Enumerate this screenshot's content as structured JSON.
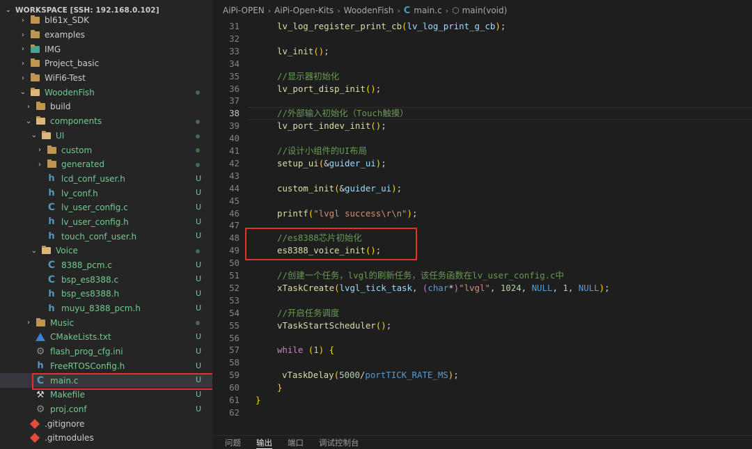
{
  "workspace_header": "WORKSPACE [SSH: 192.168.0.102]",
  "tree": [
    {
      "label": "bl61x_SDK",
      "type": "folder",
      "level": 1,
      "expanded": false
    },
    {
      "label": "examples",
      "type": "folder",
      "level": 1,
      "expanded": false
    },
    {
      "label": "IMG",
      "type": "folder-img",
      "level": 1,
      "expanded": false
    },
    {
      "label": "Project_basic",
      "type": "folder",
      "level": 1,
      "expanded": false
    },
    {
      "label": "WiFi6-Test",
      "type": "folder",
      "level": 1,
      "expanded": false
    },
    {
      "label": "WoodenFish",
      "type": "folder-open",
      "level": 1,
      "expanded": true,
      "dot": true,
      "git": "new"
    },
    {
      "label": "build",
      "type": "folder",
      "level": 2,
      "expanded": false
    },
    {
      "label": "components",
      "type": "folder-open",
      "level": 2,
      "expanded": true,
      "dot": true,
      "git": "new"
    },
    {
      "label": "UI",
      "type": "folder-open",
      "level": 3,
      "expanded": true,
      "dot": true,
      "git": "new"
    },
    {
      "label": "custom",
      "type": "folder",
      "level": 4,
      "expanded": false,
      "dot": true,
      "git": "new"
    },
    {
      "label": "generated",
      "type": "folder",
      "level": 4,
      "expanded": false,
      "dot": true,
      "git": "new"
    },
    {
      "label": "lcd_conf_user.h",
      "type": "h",
      "level": 4,
      "badge": "U",
      "git": "new"
    },
    {
      "label": "lv_conf.h",
      "type": "h",
      "level": 4,
      "badge": "U",
      "git": "new"
    },
    {
      "label": "lv_user_config.c",
      "type": "c",
      "level": 4,
      "badge": "U",
      "git": "new"
    },
    {
      "label": "lv_user_config.h",
      "type": "h",
      "level": 4,
      "badge": "U",
      "git": "new"
    },
    {
      "label": "touch_conf_user.h",
      "type": "h",
      "level": 4,
      "badge": "U",
      "git": "new"
    },
    {
      "label": "Voice",
      "type": "folder-open",
      "level": 3,
      "expanded": true,
      "dot": true,
      "git": "new"
    },
    {
      "label": "8388_pcm.c",
      "type": "c",
      "level": 4,
      "badge": "U",
      "git": "new"
    },
    {
      "label": "bsp_es8388.c",
      "type": "c",
      "level": 4,
      "badge": "U",
      "git": "new"
    },
    {
      "label": "bsp_es8388.h",
      "type": "h",
      "level": 4,
      "badge": "U",
      "git": "new"
    },
    {
      "label": "muyu_8388_pcm.h",
      "type": "h",
      "level": 4,
      "badge": "U",
      "git": "new"
    },
    {
      "label": "Music",
      "type": "folder",
      "level": 2,
      "expanded": false,
      "dot": true,
      "git": "new"
    },
    {
      "label": "CMakeLists.txt",
      "type": "cmake",
      "level": 2,
      "badge": "U",
      "git": "new"
    },
    {
      "label": "flash_prog_cfg.ini",
      "type": "gear",
      "level": 2,
      "badge": "U",
      "git": "new"
    },
    {
      "label": "FreeRTOSConfig.h",
      "type": "h",
      "level": 2,
      "badge": "U",
      "git": "new"
    },
    {
      "label": "main.c",
      "type": "c",
      "level": 2,
      "badge": "U",
      "git": "new",
      "selected": true
    },
    {
      "label": "Makefile",
      "type": "make",
      "level": 2,
      "badge": "U",
      "git": "new"
    },
    {
      "label": "proj.conf",
      "type": "gear",
      "level": 2,
      "badge": "U",
      "git": "new"
    },
    {
      "label": ".gitignore",
      "type": "git",
      "level": 1
    },
    {
      "label": ".gitmodules",
      "type": "git",
      "level": 1
    }
  ],
  "breadcrumb": {
    "items": [
      "AiPi-OPEN",
      "AiPi-Open-Kits",
      "WoodenFish"
    ],
    "file": "main.c",
    "symbol": "main(void)"
  },
  "code": {
    "current_line": 38,
    "lines": [
      {
        "n": "31",
        "text": "lv_log_register_print_cb(lv_log_print_g_cb);"
      },
      {
        "n": "32",
        "text": ""
      },
      {
        "n": "33",
        "text": "lv_init();"
      },
      {
        "n": "34",
        "text": ""
      },
      {
        "n": "35",
        "text": "//显示器初始化"
      },
      {
        "n": "36",
        "text": "lv_port_disp_init();"
      },
      {
        "n": "37",
        "text": ""
      },
      {
        "n": "38",
        "text": "//外部输入初始化（Touch触摸）"
      },
      {
        "n": "39",
        "text": "lv_port_indev_init();"
      },
      {
        "n": "40",
        "text": ""
      },
      {
        "n": "41",
        "text": "//设计小组件的UI布局"
      },
      {
        "n": "42",
        "text": "setup_ui(&guider_ui);"
      },
      {
        "n": "43",
        "text": ""
      },
      {
        "n": "44",
        "text": "custom_init(&guider_ui);"
      },
      {
        "n": "45",
        "text": ""
      },
      {
        "n": "46",
        "text": "printf(\"lvgl success\\r\\n\");"
      },
      {
        "n": "47",
        "text": ""
      },
      {
        "n": "48",
        "text": "//es8388芯片初始化"
      },
      {
        "n": "49",
        "text": "es8388_voice_init();"
      },
      {
        "n": "50",
        "text": ""
      },
      {
        "n": "51",
        "text": "//创建一个任务，lvgl的刷新任务，该任务函数在lv_user_config.c中"
      },
      {
        "n": "52",
        "text": "xTaskCreate(lvgl_tick_task, (char*)\"lvgl\", 1024, NULL, 1, NULL);"
      },
      {
        "n": "53",
        "text": ""
      },
      {
        "n": "54",
        "text": "//开启任务调度"
      },
      {
        "n": "55",
        "text": "vTaskStartScheduler();"
      },
      {
        "n": "56",
        "text": ""
      },
      {
        "n": "57",
        "text": "while (1) {"
      },
      {
        "n": "58",
        "text": ""
      },
      {
        "n": "59",
        "text": "vTaskDelay(5000/portTICK_RATE_MS);"
      },
      {
        "n": "60",
        "text": "}"
      },
      {
        "n": "61",
        "text": "}"
      },
      {
        "n": "62",
        "text": ""
      }
    ]
  },
  "panel_tabs": [
    "问题",
    "输出",
    "端口",
    "调试控制台"
  ],
  "colors": {
    "sidebar_bg": "#252526",
    "editor_bg": "#1e1e1e",
    "highlight_box": "#e8302a",
    "git_untracked": "#73c991"
  }
}
